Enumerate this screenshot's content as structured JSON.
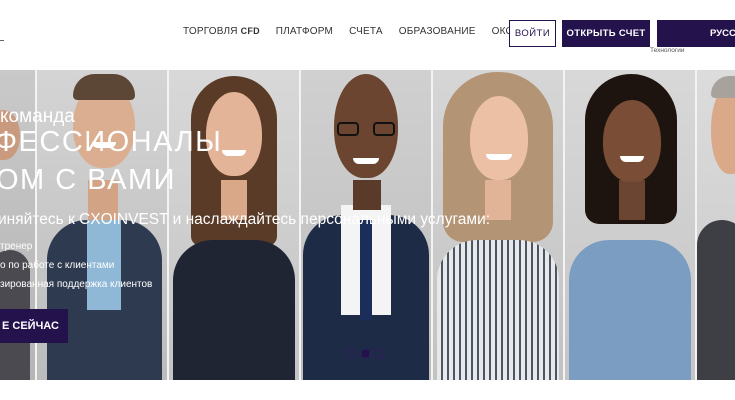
{
  "header": {
    "nav": [
      {
        "label": "ТОРГОВЛЯ",
        "sub": "CFD"
      },
      {
        "label": "ПЛАТФОРМ",
        "sub": ""
      },
      {
        "label": "СЧЕТА",
        "sub": ""
      },
      {
        "label": "ОБРАЗОВАНИЕ",
        "sub": ""
      },
      {
        "label": "ОКОЛО",
        "sub": ""
      }
    ],
    "login_label": "ВОЙТИ",
    "open_account_label": "ОТКРЫТЬ СЧЕТ",
    "language_label": "РУСС",
    "tech_note": "Технологии"
  },
  "hero": {
    "team_line": "команда",
    "headline_line1": "ФЕССИОНАЛЫ",
    "headline_line2": "ОМ С ВАМИ",
    "subheadline": "иняйтесь к CXOINVEST и наслаждайтесь персональными услугами:",
    "list_items": [
      "тренер",
      "о по работе с клиентами",
      "зированная поддержка клиентов"
    ],
    "cta_label": "Е СЕЙЧАС",
    "slides_total": 3,
    "slide_active": 2
  },
  "colors": {
    "brand": "#24124d",
    "text": "#333333",
    "hero_text": "#ffffff"
  }
}
